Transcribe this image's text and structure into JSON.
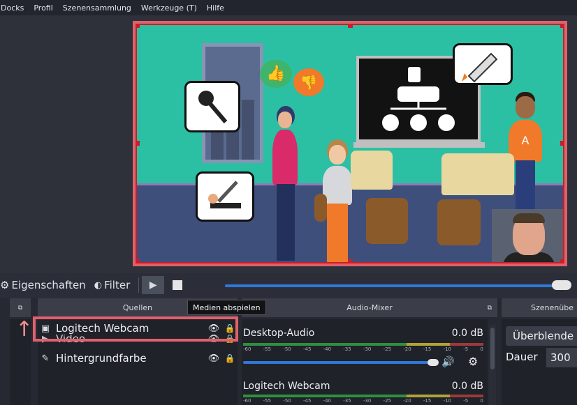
{
  "menu": [
    "Docks",
    "Profil",
    "Szenensammlung",
    "Werkzeuge (T)",
    "Hilfe"
  ],
  "toolbar": {
    "properties_label": "Eigenschaften",
    "filter_label": "Filter",
    "play_tooltip": "Medien abspielen"
  },
  "docks": {
    "sources_title": "Quellen",
    "mixer_title": "Audio-Mixer",
    "transitions_title": "Szenenübe"
  },
  "sources": [
    {
      "name": "Logitech Webcam",
      "icon": "camera-icon"
    },
    {
      "name": "Video",
      "icon": "play-icon"
    },
    {
      "name": "Hintergrundfarbe",
      "icon": "brush-icon"
    }
  ],
  "mixer": [
    {
      "name": "Desktop-Audio",
      "db": "0.0 dB"
    },
    {
      "name": "Logitech Webcam",
      "db": "0.0 dB"
    }
  ],
  "meter_scale": [
    "-60",
    "-55",
    "-50",
    "-45",
    "-40",
    "-35",
    "-30",
    "-25",
    "-20",
    "-15",
    "-10",
    "-5",
    "0"
  ],
  "transitions": {
    "selected": "Überblende",
    "duration_label": "Dauer",
    "duration_value": "300"
  },
  "scene_letter": "A",
  "colors": {
    "accent_highlight": "#e0616c",
    "selection_red": "#c81f28",
    "slider_blue": "#2f78d8"
  }
}
